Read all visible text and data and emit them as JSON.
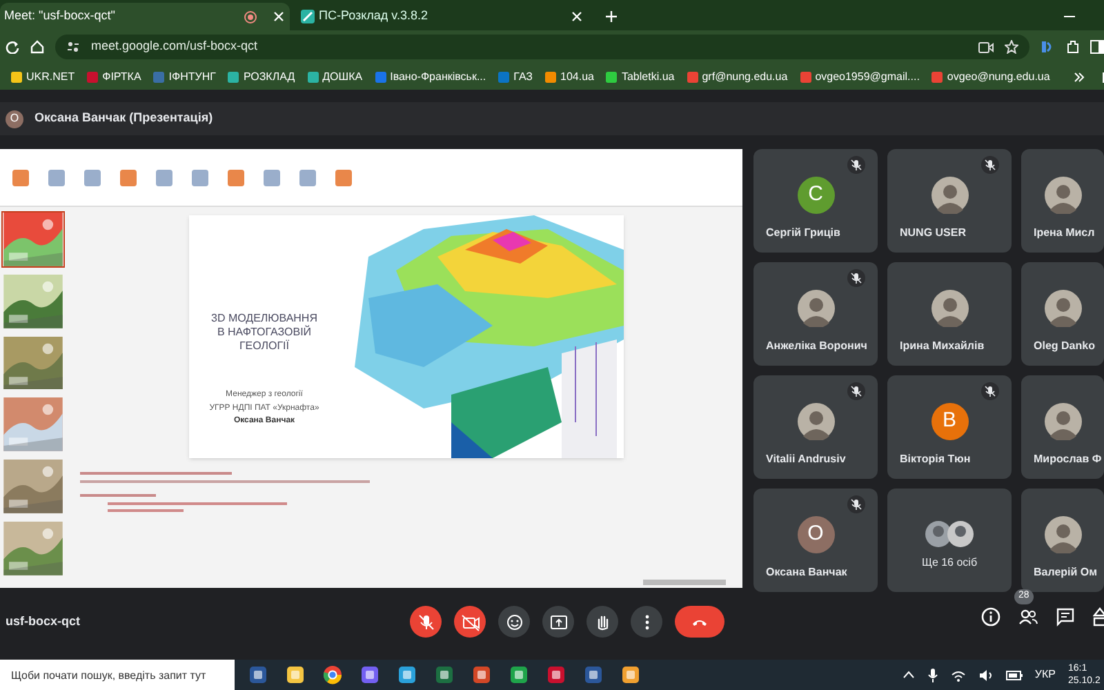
{
  "browser": {
    "tabs": [
      {
        "title": "Meet: \"usf-bocx-qct\"",
        "selected": true
      },
      {
        "title": "ПС-Розклад v.3.8.2",
        "selected": false
      }
    ],
    "address": "meet.google.com/usf-bocx-qct",
    "bookmarks": [
      {
        "label": "UKR.NET",
        "color": "#f5c518"
      },
      {
        "label": "ФІРТКА",
        "color": "#c8102e"
      },
      {
        "label": "ІФНТУНГ",
        "color": "#3a6ea5"
      },
      {
        "label": "РОЗКЛАД",
        "color": "#2bb3a3"
      },
      {
        "label": "ДОШКА",
        "color": "#2bb3a3"
      },
      {
        "label": "Івано-Франківськ...",
        "color": "#1a73e8"
      },
      {
        "label": "ГАЗ",
        "color": "#0b74c4"
      },
      {
        "label": "104.ua",
        "color": "#f28b00"
      },
      {
        "label": "Tabletki.ua",
        "color": "#2ecc40"
      },
      {
        "label": "grf@nung.edu.ua",
        "color": "#ea4335"
      },
      {
        "label": "ovgeo1959@gmail....",
        "color": "#ea4335"
      },
      {
        "label": "ovgeo@nung.edu.ua",
        "color": "#ea4335"
      }
    ]
  },
  "presenter": {
    "initial": "О",
    "label": "Оксана Ванчак (Презентація)"
  },
  "slide": {
    "title_lines": [
      "3D МОДЕЛЮВАННЯ",
      "В НАФТОГАЗОВІЙ",
      "ГЕОЛОГІЇ"
    ],
    "subtitle_lines": [
      "Менеджер з геології",
      "УГРР НДПІ ПАТ «Укрнафта»"
    ],
    "author": "Оксана Ванчак"
  },
  "participants": [
    {
      "name": "Сергій Гриців",
      "kind": "letter",
      "initial": "С",
      "color": "#5f9c2f",
      "muted": true
    },
    {
      "name": "NUNG USER",
      "muted": true
    },
    {
      "name": "Ірена Мисл",
      "muted": false
    },
    {
      "name": "Анжеліка Воронич",
      "muted": true
    },
    {
      "name": "Ірина Михайлів",
      "muted": false
    },
    {
      "name": "Oleg Danko",
      "muted": false
    },
    {
      "name": "Vitalii Andrusiv",
      "muted": true
    },
    {
      "name": "Вікторія Тюн",
      "kind": "letter",
      "initial": "В",
      "color": "#e8710a",
      "muted": true
    },
    {
      "name": "Мирослав Ф",
      "muted": false
    },
    {
      "name": "Оксана Ванчак",
      "kind": "letter",
      "initial": "О",
      "color": "#8d6e63",
      "muted": true
    },
    {
      "name": "Ще 16 осіб",
      "kind": "more",
      "muted": false
    },
    {
      "name": "Валерій Ом",
      "muted": false
    }
  ],
  "meeting_code": "usf-bocx-qct",
  "controls": [
    {
      "kind": "mic",
      "off": true
    },
    {
      "kind": "camera",
      "off": true
    },
    {
      "kind": "emoji",
      "off": false
    },
    {
      "kind": "present",
      "off": false
    },
    {
      "kind": "hand",
      "off": false
    },
    {
      "kind": "more",
      "off": false
    },
    {
      "kind": "end",
      "off": true
    }
  ],
  "people_count": "28",
  "taskbar": {
    "search_placeholder": "Щоби почати пошук, введіть запит тут",
    "language": "УКР",
    "time": "16:1",
    "date": "25.10.2"
  }
}
